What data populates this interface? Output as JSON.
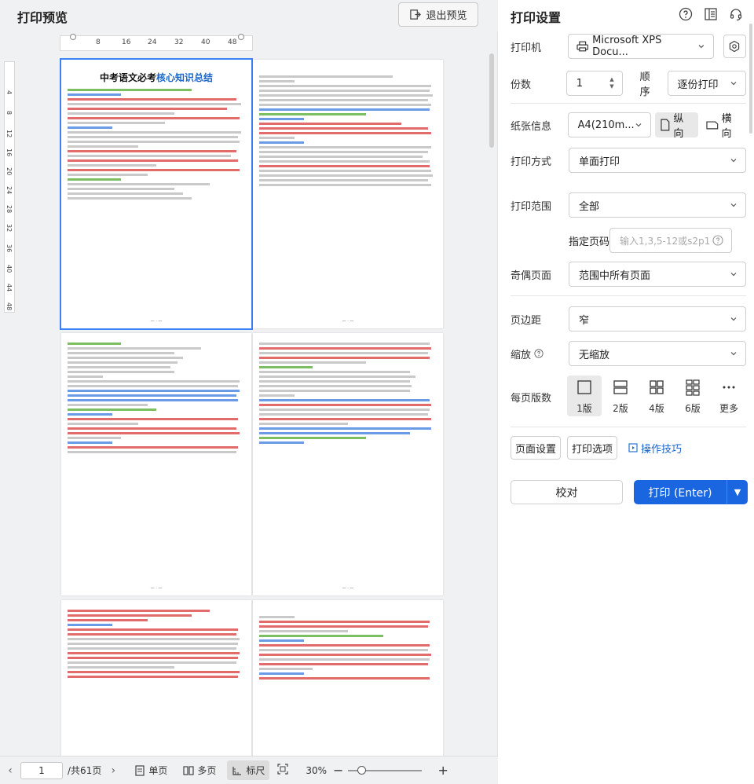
{
  "left_panel": {
    "title": "打印预览",
    "exit_button": "退出预览",
    "hruler_ticks": [
      "8",
      "16",
      "24",
      "32",
      "40",
      "48"
    ],
    "vruler_ticks": [
      "4",
      "8",
      "12",
      "16",
      "20",
      "24",
      "28",
      "32",
      "36",
      "40",
      "44",
      "48"
    ],
    "page1_title_a": "中考语文必考",
    "page1_title_b": "核心知识总结"
  },
  "bottom_bar": {
    "current_page": "1",
    "total_pages": "/共61页",
    "single_page": "单页",
    "multi_page": "多页",
    "ruler": "标尺",
    "zoom": "30%",
    "zoom_minus": "−",
    "zoom_plus": "+"
  },
  "settings": {
    "title": "打印设置",
    "printer_label": "打印机",
    "printer_value": "Microsoft XPS Docu...",
    "copies_label": "份数",
    "copies_value": "1",
    "order_label": "顺序",
    "order_value": "逐份打印",
    "paper_label": "纸张信息",
    "paper_value": "A4(210m...",
    "portrait": "纵向",
    "landscape": "横向",
    "print_mode_label": "打印方式",
    "print_mode_value": "单面打印",
    "range_label": "打印范围",
    "range_value": "全部",
    "specify_label": "指定页码",
    "specify_placeholder": "输入1,3,5-12或s2p1",
    "odd_even_label": "奇偶页面",
    "odd_even_value": "范围中所有页面",
    "margin_label": "页边距",
    "margin_value": "窄",
    "scale_label": "缩放",
    "scale_value": "无缩放",
    "pages_per_sheet_label": "每页版数",
    "layouts": [
      "1版",
      "2版",
      "4版",
      "6版",
      "更多"
    ],
    "page_setup": "页面设置",
    "print_options": "打印选项",
    "tips": "操作技巧",
    "proof": "校对",
    "print": "打印 (Enter)"
  }
}
